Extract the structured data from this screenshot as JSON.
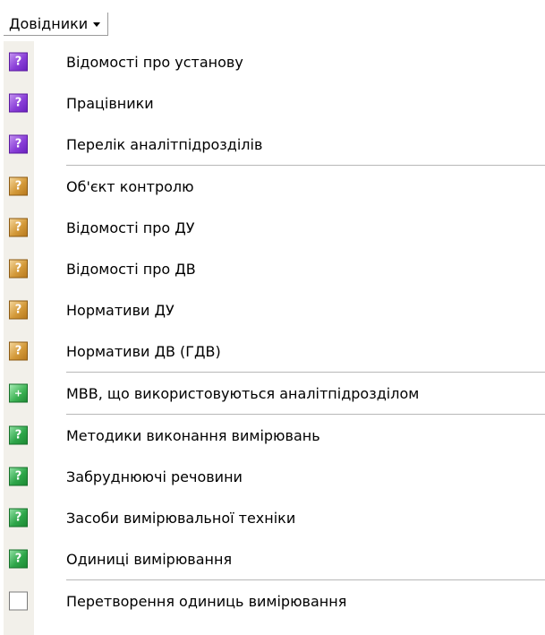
{
  "menu": {
    "title": "Довідники"
  },
  "items": [
    {
      "label": "Відомості про установу",
      "icon": "help-purple-icon"
    },
    {
      "label": "Працівники",
      "icon": "help-purple-icon"
    },
    {
      "label": "Перелік аналітпідрозділів",
      "icon": "help-purple-icon"
    },
    {
      "label": "Об'єкт контролю",
      "icon": "help-orange-icon"
    },
    {
      "label": "Відомості про ДУ",
      "icon": "help-orange-icon"
    },
    {
      "label": "Відомості про ДВ",
      "icon": "help-orange-icon"
    },
    {
      "label": "Нормативи ДУ",
      "icon": "help-orange-icon"
    },
    {
      "label": "Нормативи ДВ (ГДВ)",
      "icon": "help-orange-icon"
    },
    {
      "label": "МВВ, що використовуються аналітпідрозділом",
      "icon": "add-green-icon"
    },
    {
      "label": "Методики виконання вимірювань",
      "icon": "help-green-icon"
    },
    {
      "label": "Забруднюючі речовини",
      "icon": "help-green-icon"
    },
    {
      "label": "Засоби вимірювальної техніки",
      "icon": "help-green-icon"
    },
    {
      "label": "Одиниці вимірювання",
      "icon": "help-green-icon"
    },
    {
      "label": "Перетворення одиниць вимірювання",
      "icon": "grid-conversion-icon"
    }
  ],
  "icon_glyphs": {
    "help": "?",
    "add": "+"
  },
  "colors": {
    "gutter": "#f2f0ea",
    "purple": "#8a3fd8",
    "orange": "#d49a3a",
    "green": "#2fa64a"
  }
}
